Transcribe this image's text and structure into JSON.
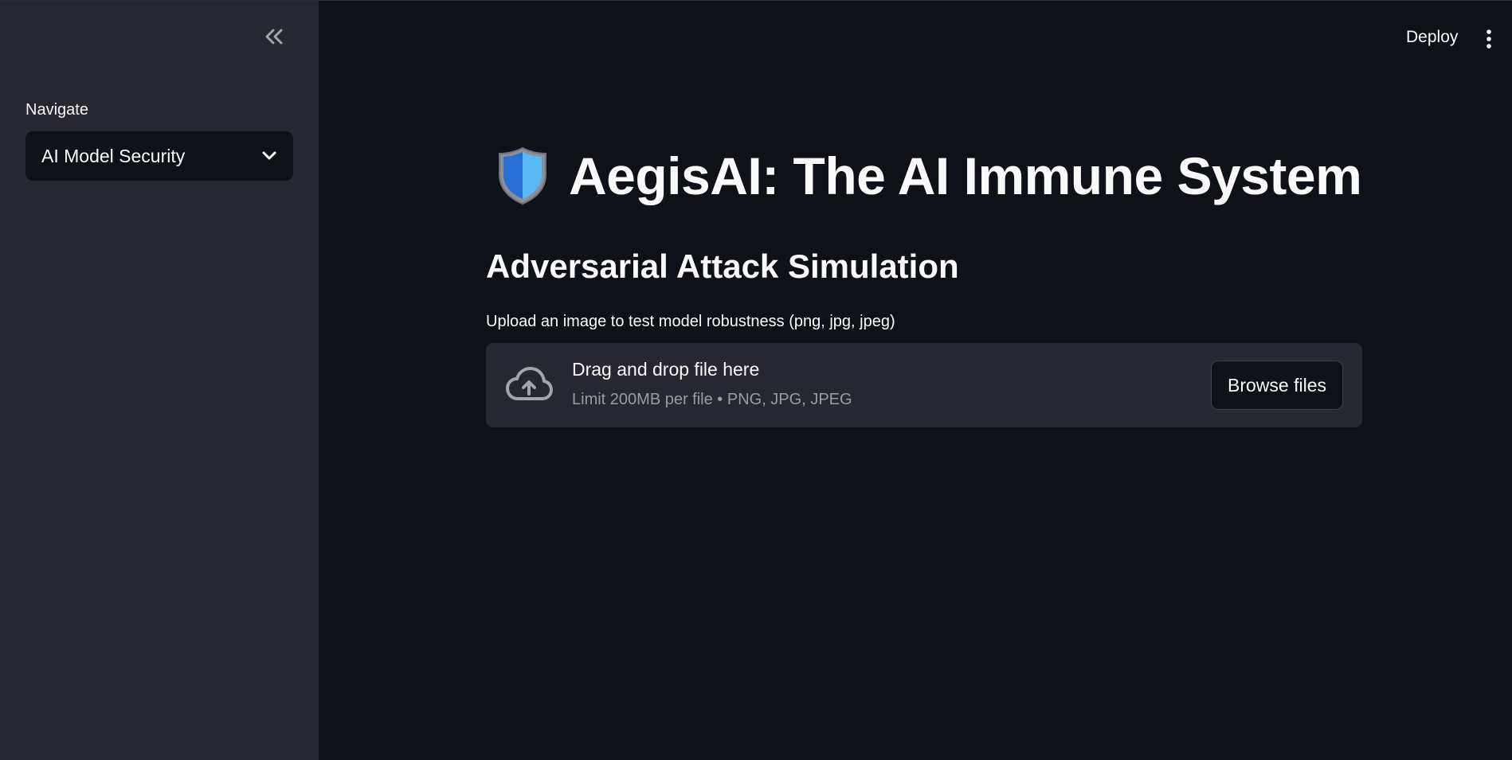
{
  "sidebar": {
    "collapse_icon": "double-chevron-left-icon",
    "nav_label": "Navigate",
    "nav_selected": "AI Model Security",
    "nav_dropdown_icon": "chevron-down-icon"
  },
  "header": {
    "deploy_label": "Deploy",
    "menu_icon": "kebab-menu-icon"
  },
  "main": {
    "title_icon": "shield-icon",
    "title": "AegisAI: The AI Immune System",
    "subheader": "Adversarial Attack Simulation",
    "uploader": {
      "label": "Upload an image to test model robustness (png, jpg, jpeg)",
      "icon": "cloud-upload-icon",
      "drop_text": "Drag and drop file here",
      "limit_text": "Limit 200MB per file • PNG, JPG, JPEG",
      "browse_label": "Browse files"
    }
  },
  "colors": {
    "background": "#0e1117",
    "sidebar": "#262730",
    "text": "#fafafa",
    "muted_text": "#9a9ba3",
    "shield_light": "#5ab8f5",
    "shield_dark": "#2a6fd6"
  }
}
